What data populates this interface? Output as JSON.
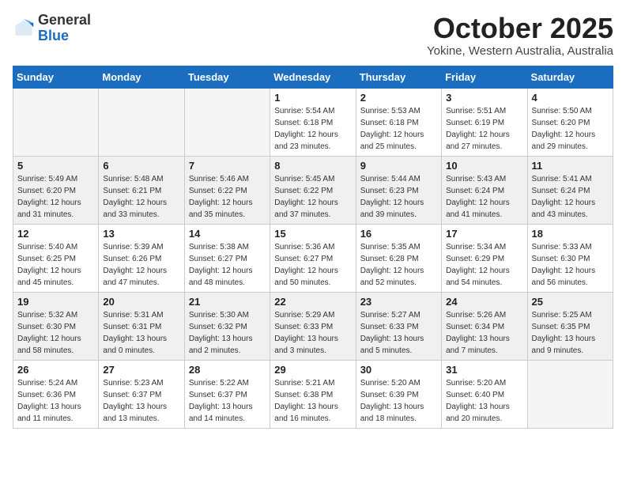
{
  "header": {
    "logo_general": "General",
    "logo_blue": "Blue",
    "month_title": "October 2025",
    "subtitle": "Yokine, Western Australia, Australia"
  },
  "weekdays": [
    "Sunday",
    "Monday",
    "Tuesday",
    "Wednesday",
    "Thursday",
    "Friday",
    "Saturday"
  ],
  "weeks": [
    [
      {
        "day": "",
        "info": ""
      },
      {
        "day": "",
        "info": ""
      },
      {
        "day": "",
        "info": ""
      },
      {
        "day": "1",
        "info": "Sunrise: 5:54 AM\nSunset: 6:18 PM\nDaylight: 12 hours\nand 23 minutes."
      },
      {
        "day": "2",
        "info": "Sunrise: 5:53 AM\nSunset: 6:18 PM\nDaylight: 12 hours\nand 25 minutes."
      },
      {
        "day": "3",
        "info": "Sunrise: 5:51 AM\nSunset: 6:19 PM\nDaylight: 12 hours\nand 27 minutes."
      },
      {
        "day": "4",
        "info": "Sunrise: 5:50 AM\nSunset: 6:20 PM\nDaylight: 12 hours\nand 29 minutes."
      }
    ],
    [
      {
        "day": "5",
        "info": "Sunrise: 5:49 AM\nSunset: 6:20 PM\nDaylight: 12 hours\nand 31 minutes."
      },
      {
        "day": "6",
        "info": "Sunrise: 5:48 AM\nSunset: 6:21 PM\nDaylight: 12 hours\nand 33 minutes."
      },
      {
        "day": "7",
        "info": "Sunrise: 5:46 AM\nSunset: 6:22 PM\nDaylight: 12 hours\nand 35 minutes."
      },
      {
        "day": "8",
        "info": "Sunrise: 5:45 AM\nSunset: 6:22 PM\nDaylight: 12 hours\nand 37 minutes."
      },
      {
        "day": "9",
        "info": "Sunrise: 5:44 AM\nSunset: 6:23 PM\nDaylight: 12 hours\nand 39 minutes."
      },
      {
        "day": "10",
        "info": "Sunrise: 5:43 AM\nSunset: 6:24 PM\nDaylight: 12 hours\nand 41 minutes."
      },
      {
        "day": "11",
        "info": "Sunrise: 5:41 AM\nSunset: 6:24 PM\nDaylight: 12 hours\nand 43 minutes."
      }
    ],
    [
      {
        "day": "12",
        "info": "Sunrise: 5:40 AM\nSunset: 6:25 PM\nDaylight: 12 hours\nand 45 minutes."
      },
      {
        "day": "13",
        "info": "Sunrise: 5:39 AM\nSunset: 6:26 PM\nDaylight: 12 hours\nand 47 minutes."
      },
      {
        "day": "14",
        "info": "Sunrise: 5:38 AM\nSunset: 6:27 PM\nDaylight: 12 hours\nand 48 minutes."
      },
      {
        "day": "15",
        "info": "Sunrise: 5:36 AM\nSunset: 6:27 PM\nDaylight: 12 hours\nand 50 minutes."
      },
      {
        "day": "16",
        "info": "Sunrise: 5:35 AM\nSunset: 6:28 PM\nDaylight: 12 hours\nand 52 minutes."
      },
      {
        "day": "17",
        "info": "Sunrise: 5:34 AM\nSunset: 6:29 PM\nDaylight: 12 hours\nand 54 minutes."
      },
      {
        "day": "18",
        "info": "Sunrise: 5:33 AM\nSunset: 6:30 PM\nDaylight: 12 hours\nand 56 minutes."
      }
    ],
    [
      {
        "day": "19",
        "info": "Sunrise: 5:32 AM\nSunset: 6:30 PM\nDaylight: 12 hours\nand 58 minutes."
      },
      {
        "day": "20",
        "info": "Sunrise: 5:31 AM\nSunset: 6:31 PM\nDaylight: 13 hours\nand 0 minutes."
      },
      {
        "day": "21",
        "info": "Sunrise: 5:30 AM\nSunset: 6:32 PM\nDaylight: 13 hours\nand 2 minutes."
      },
      {
        "day": "22",
        "info": "Sunrise: 5:29 AM\nSunset: 6:33 PM\nDaylight: 13 hours\nand 3 minutes."
      },
      {
        "day": "23",
        "info": "Sunrise: 5:27 AM\nSunset: 6:33 PM\nDaylight: 13 hours\nand 5 minutes."
      },
      {
        "day": "24",
        "info": "Sunrise: 5:26 AM\nSunset: 6:34 PM\nDaylight: 13 hours\nand 7 minutes."
      },
      {
        "day": "25",
        "info": "Sunrise: 5:25 AM\nSunset: 6:35 PM\nDaylight: 13 hours\nand 9 minutes."
      }
    ],
    [
      {
        "day": "26",
        "info": "Sunrise: 5:24 AM\nSunset: 6:36 PM\nDaylight: 13 hours\nand 11 minutes."
      },
      {
        "day": "27",
        "info": "Sunrise: 5:23 AM\nSunset: 6:37 PM\nDaylight: 13 hours\nand 13 minutes."
      },
      {
        "day": "28",
        "info": "Sunrise: 5:22 AM\nSunset: 6:37 PM\nDaylight: 13 hours\nand 14 minutes."
      },
      {
        "day": "29",
        "info": "Sunrise: 5:21 AM\nSunset: 6:38 PM\nDaylight: 13 hours\nand 16 minutes."
      },
      {
        "day": "30",
        "info": "Sunrise: 5:20 AM\nSunset: 6:39 PM\nDaylight: 13 hours\nand 18 minutes."
      },
      {
        "day": "31",
        "info": "Sunrise: 5:20 AM\nSunset: 6:40 PM\nDaylight: 13 hours\nand 20 minutes."
      },
      {
        "day": "",
        "info": ""
      }
    ]
  ]
}
